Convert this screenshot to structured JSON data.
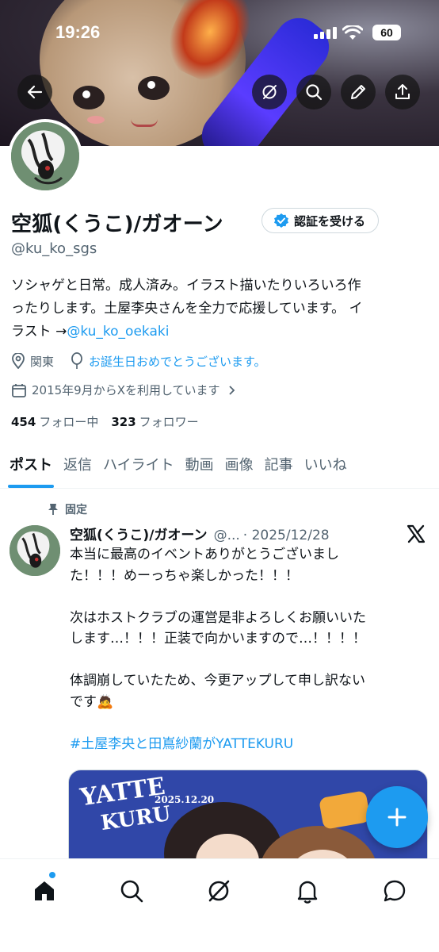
{
  "status_bar": {
    "time": "19:26",
    "battery": "60"
  },
  "profile": {
    "display_name": "空狐(くうこ)/ガオーン",
    "verify_label": "認証を受ける",
    "handle": "@ku_ko_sgs",
    "bio_line1": "ソシャゲと日常。成人済み。イラスト描いたりいろいろ作",
    "bio_line2": "ったりします。土屋李央さんを全力で応援しています。 イ",
    "bio_line3_prefix": "ラスト →",
    "bio_link": "@ku_ko_oekaki",
    "location": "関東",
    "birthday": "お誕生日おめでとうございます。",
    "joined": "2015年9月からXを利用しています",
    "following_count": "454",
    "following_label": "フォロー中",
    "followers_count": "323",
    "followers_label": "フォロワー"
  },
  "tabs": [
    {
      "label": "ポスト",
      "active": true
    },
    {
      "label": "返信"
    },
    {
      "label": "ハイライト"
    },
    {
      "label": "動画"
    },
    {
      "label": "画像"
    },
    {
      "label": "記事"
    },
    {
      "label": "いいね"
    }
  ],
  "post": {
    "pinned_label": "固定",
    "author": "空狐(くうこ)/ガオーン",
    "handle": "@...",
    "date": "· 2025/12/28",
    "lines": [
      "本当に最高のイベントありがとうございまし",
      "た！！！めーっちゃ楽しかった！！！",
      "",
      "次はホストクラブの運営是非よろしくお願いいた",
      "します…！！！正装で向かいますので…！！！！",
      "",
      "体調崩していたため、今更アップして申し訳ない",
      "です🙇"
    ],
    "hashtag": "#土屋李央と田嶌紗蘭がYATTEKURU",
    "image_text_1": "YATTE",
    "image_text_2": "KURU",
    "image_date": "2025.12.20"
  },
  "icons": {
    "back": "back-arrow-icon",
    "grok": "grok-icon",
    "search": "search-icon",
    "edit": "pencil-icon",
    "share": "share-icon",
    "compose": "plus-icon",
    "home": "home-icon",
    "explore": "search-icon",
    "grok_nav": "grok-icon",
    "notifications": "bell-icon",
    "messages": "chat-bubble-icon"
  },
  "colors": {
    "accent": "#1d9bf0",
    "secondary_text": "#536471"
  }
}
